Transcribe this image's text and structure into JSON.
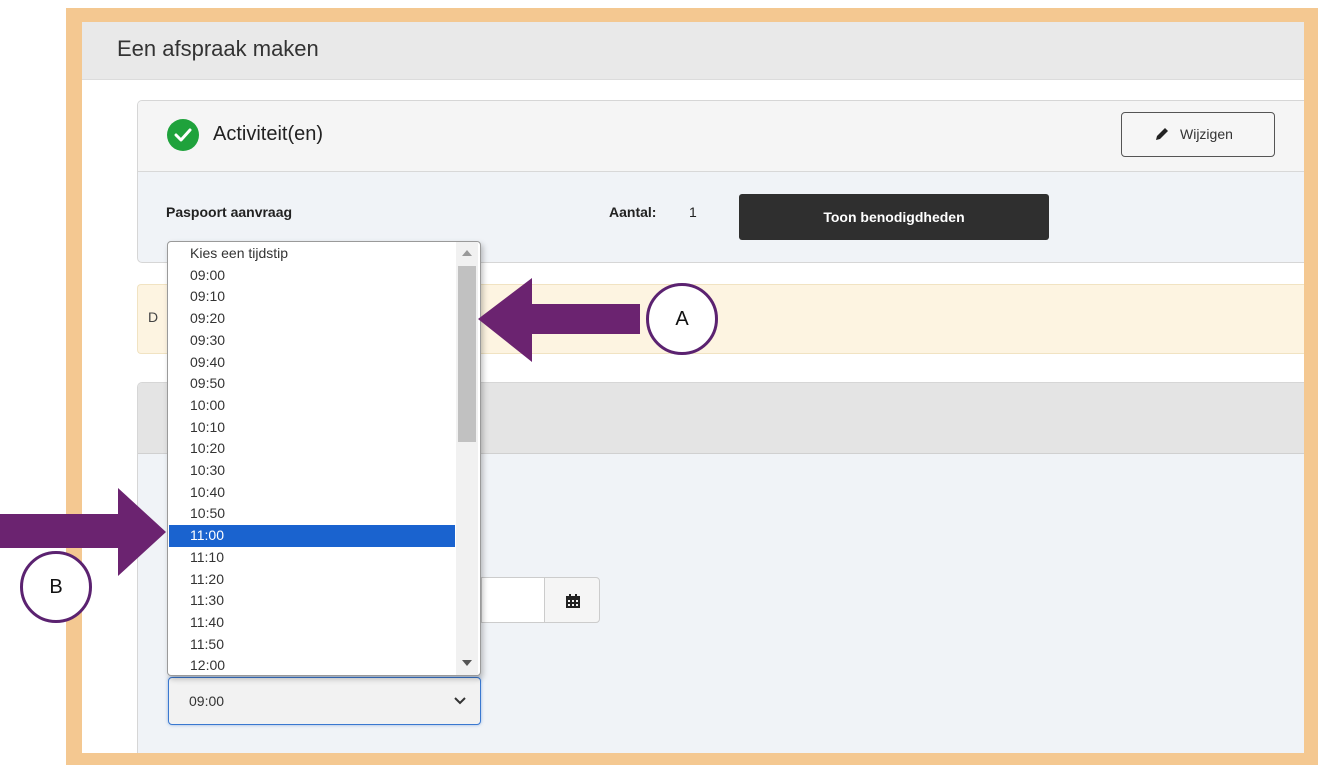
{
  "page": {
    "title": "Een afspraak maken"
  },
  "activity_panel": {
    "title": "Activiteit(en)",
    "edit_label": "Wijzigen",
    "activity_name": "Paspoort aanvraag",
    "count_label": "Aantal:",
    "count_value": "1",
    "requirements_button": "Toon benodigdheden"
  },
  "notice": {
    "text": "D"
  },
  "time_dropdown": {
    "placeholder": "Kies een tijdstip",
    "options": [
      "09:00",
      "09:10",
      "09:20",
      "09:30",
      "09:40",
      "09:50",
      "10:00",
      "10:10",
      "10:20",
      "10:30",
      "10:40",
      "10:50",
      "11:00",
      "11:10",
      "11:20",
      "11:30",
      "11:40",
      "11:50",
      "12:00"
    ],
    "highlighted": "11:00",
    "selected_value": "09:00"
  },
  "callouts": {
    "a": "A",
    "b": "B"
  },
  "colors": {
    "frame": "#f4c891",
    "arrow": "#6b2370",
    "check": "#1fa23c",
    "highlight": "#1a63cf"
  }
}
